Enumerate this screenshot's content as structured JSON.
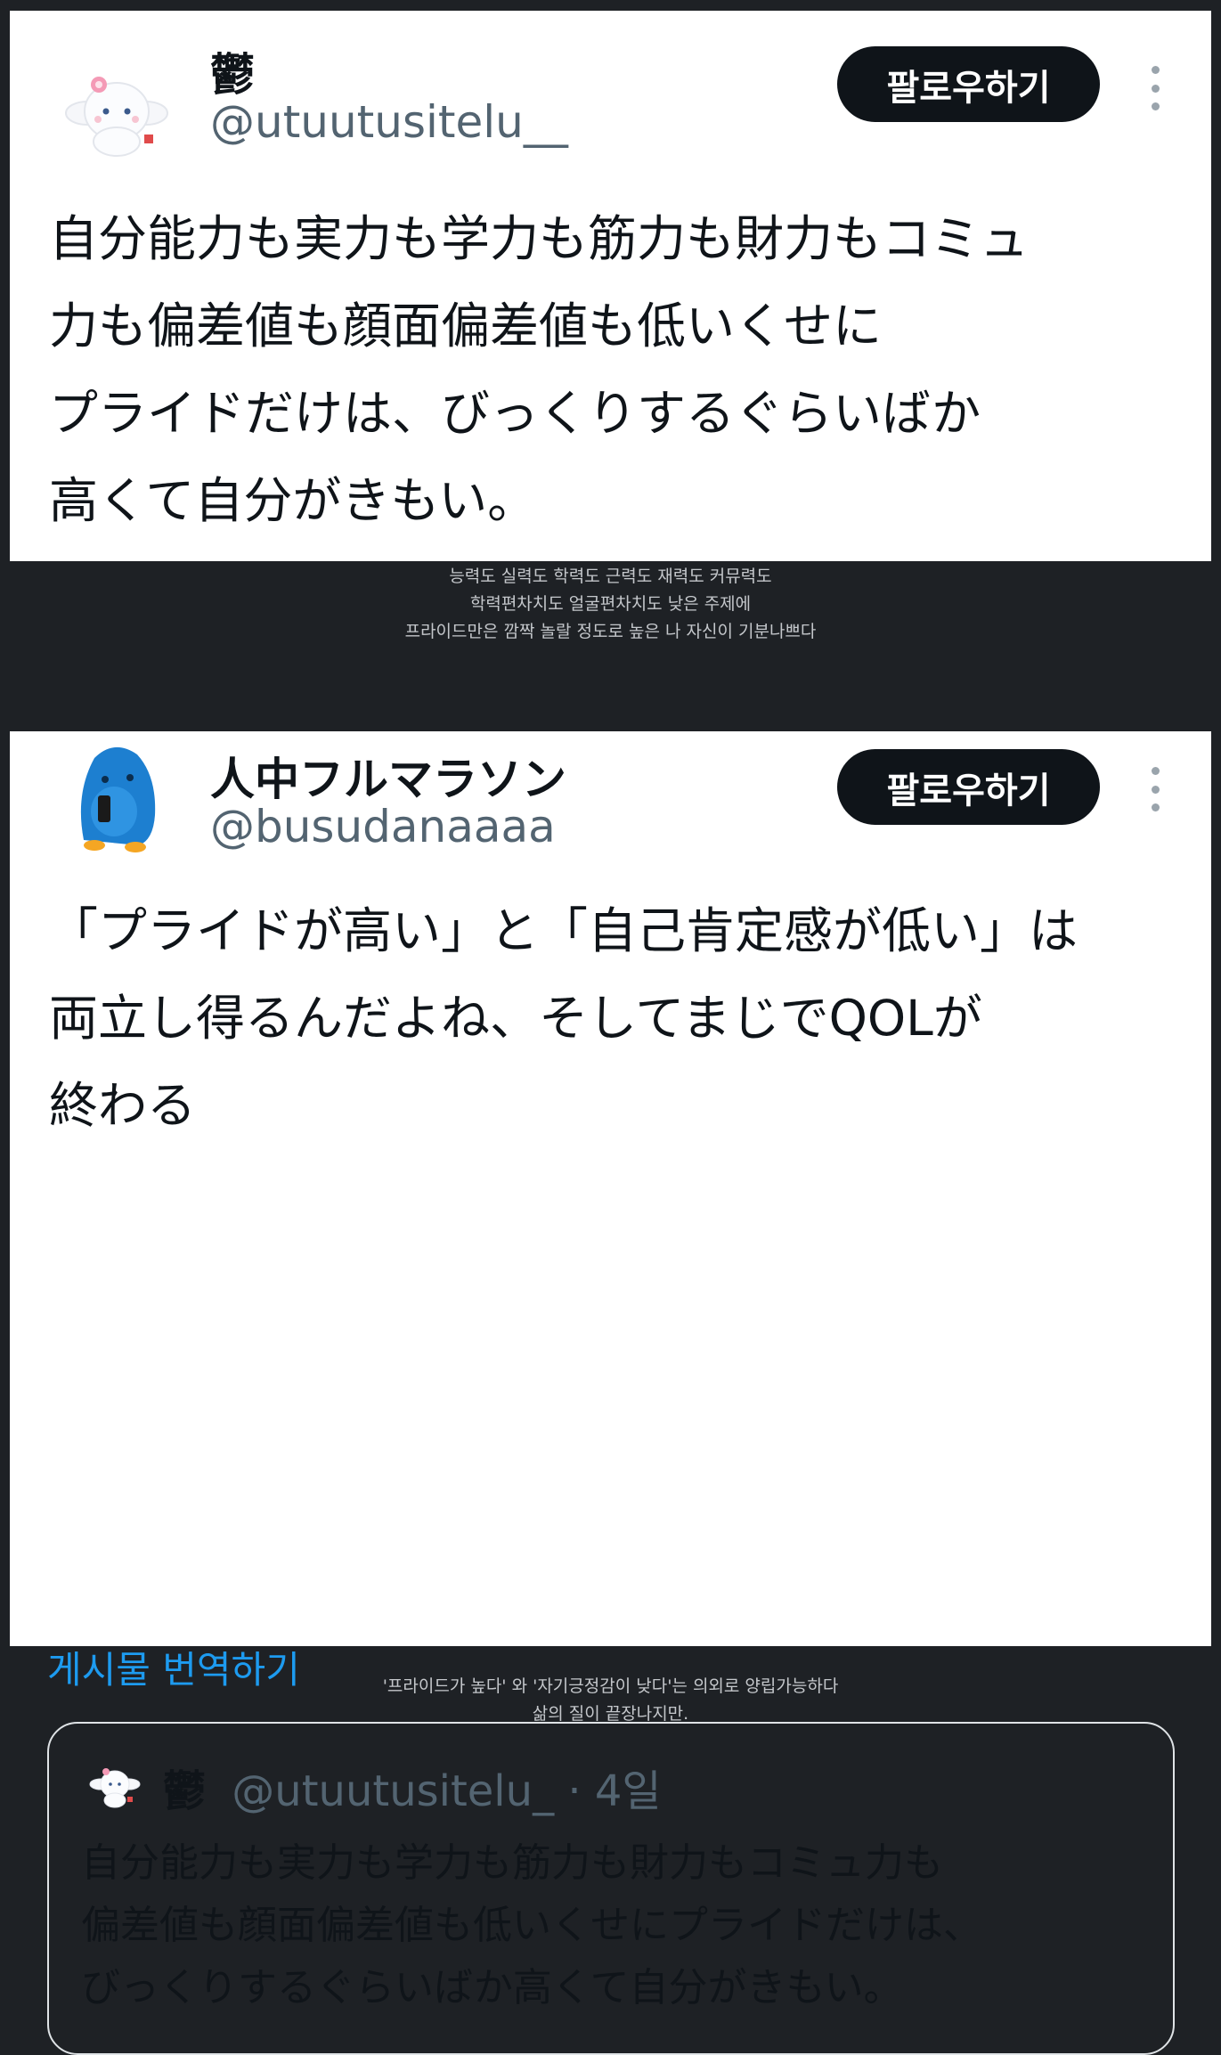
{
  "tweet1": {
    "name": "鬱",
    "handle": "@utuutusitelu__",
    "follow_label": "팔로우하기",
    "avatar": "cinnamoroll-avatar",
    "lines": [
      "自分能力も実力も学力も筋力も財力もコミュ",
      "力も偏差値も顔面偏差値も低いくせに",
      "プライドだけは、びっくりするぐらいばか",
      "高くて自分がきもい。"
    ]
  },
  "caption1": [
    "능력도 실력도 학력도 근력도 재력도 커뮤력도",
    "학력편차치도 얼굴편차치도 낮은 주제에",
    "프라이드만은 깜짝 놀랄 정도로 높은 나 자신이 기분나쁘다"
  ],
  "tweet2": {
    "name": "人中フルマラソン",
    "handle": "@busudanaaaa",
    "follow_label": "팔로우하기",
    "avatar": "blue-penguin-avatar",
    "lines": [
      "「プライドが高い」と「自己肯定感が低い」は",
      "両立し得るんだよね、そしてまじでQOLが",
      "終わる"
    ],
    "translate_label": "게시물 번역하기",
    "quote": {
      "name": "鬱",
      "handle": "@utuutusitelu_",
      "time": "· 4일",
      "lines": [
        "自分能力も実力も学力も筋力も財力もコミュ力も",
        "偏差値も顔面偏差値も低いくせにプライドだけは、",
        "びっくりするぐらいばか高くて自分がきもい。"
      ]
    }
  },
  "caption2": [
    "'프라이드가 높다' 와 '자기긍정감이 낮다'는 의외로 양립가능하다",
    "삶의 질이 끝장나지만."
  ],
  "colors": {
    "background": "#1e2125",
    "card": "#ffffff",
    "follow_button": "#0f1419",
    "link": "#1d9bf0",
    "handle": "#536471"
  }
}
